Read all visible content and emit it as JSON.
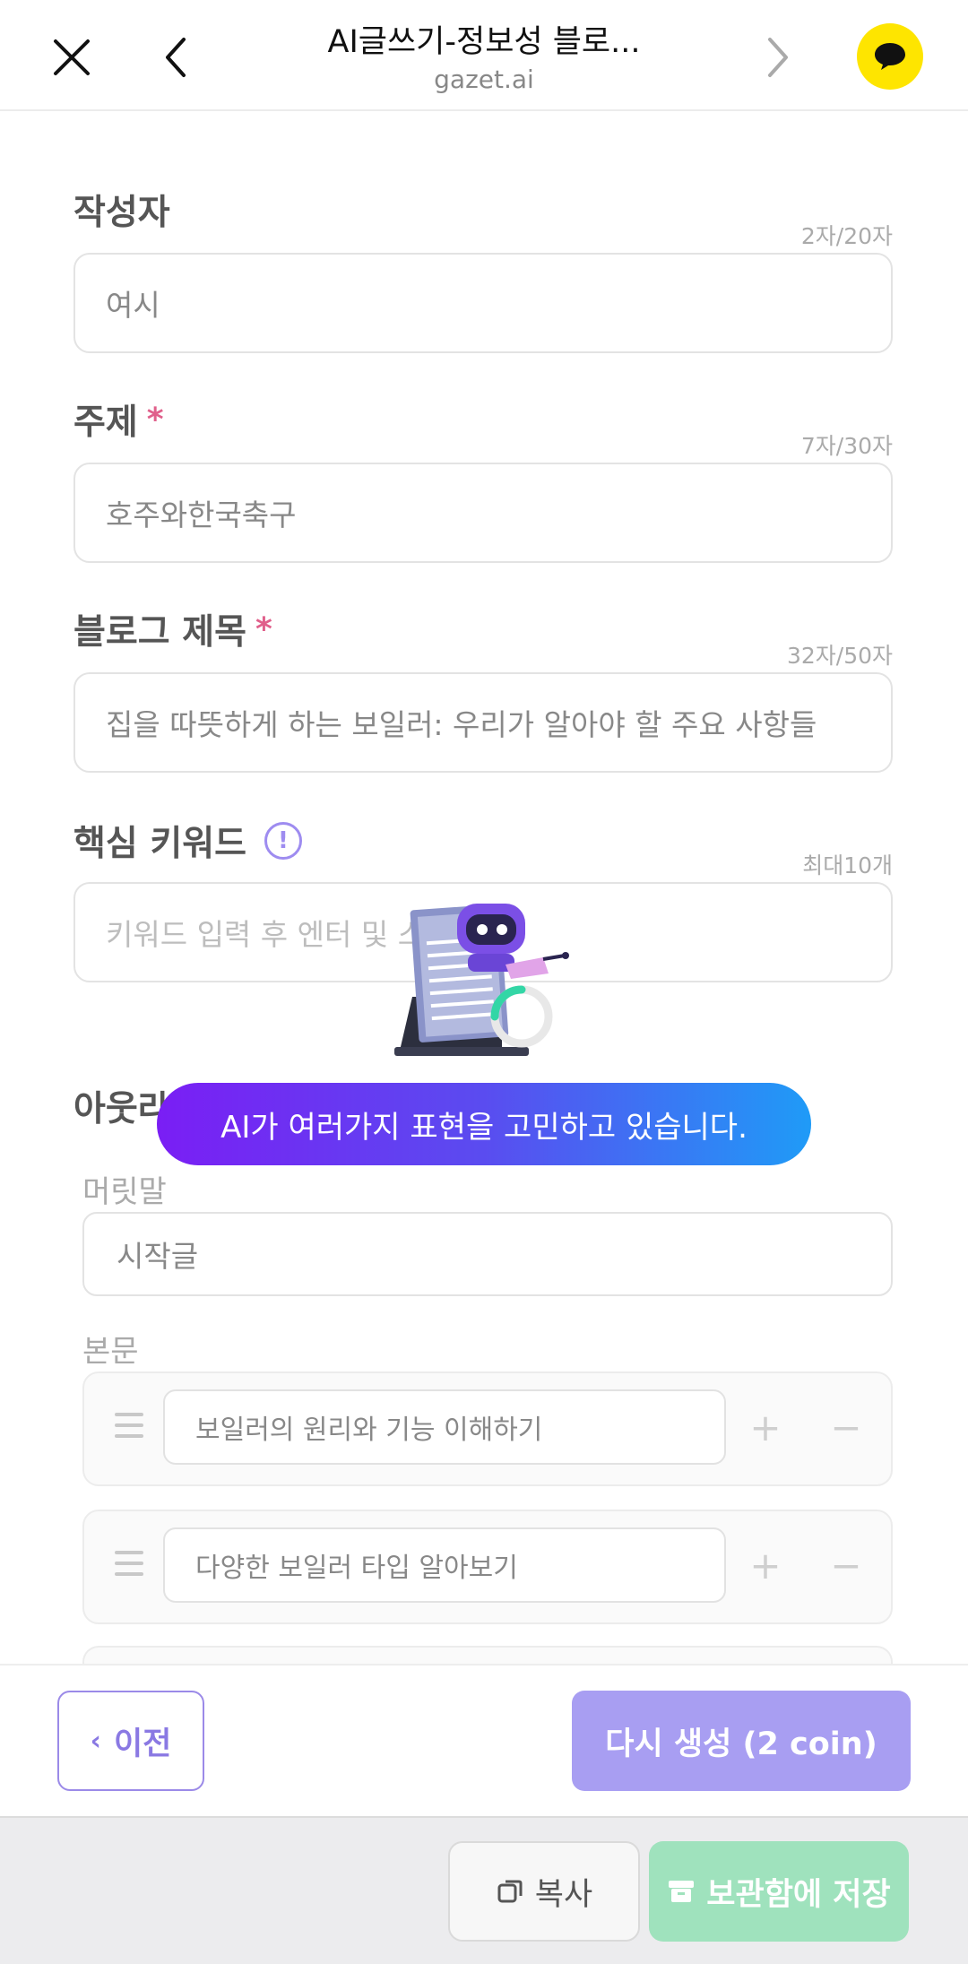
{
  "browser": {
    "title": "AI글쓰기-정보성 블로...",
    "url": "gazet.ai"
  },
  "form": {
    "author": {
      "label": "작성자",
      "counter": "2자/20자",
      "value": "여시"
    },
    "topic": {
      "label": "주제",
      "required_mark": "*",
      "counter": "7자/30자",
      "value": "호주와한국축구"
    },
    "blog_title": {
      "label": "블로그 제목",
      "required_mark": "*",
      "counter": "32자/50자",
      "value": "집을 따뜻하게 하는 보일러: 우리가 알아야 할 주요 사항들"
    },
    "keywords": {
      "label": "핵심 키워드",
      "info_icon": "!",
      "counter": "최대10개",
      "placeholder": "키워드 입력 후 엔터 및 스"
    },
    "outline": {
      "label": "아웃라",
      "intro_label": "머릿말",
      "intro_value": "시작글",
      "body_label": "본문",
      "body_items": [
        {
          "value": "보일러의 원리와 기능 이해하기",
          "plus": "+",
          "minus": "−"
        },
        {
          "value": "다양한 보일러 타입 알아보기",
          "plus": "+",
          "minus": "−"
        }
      ]
    }
  },
  "loading": {
    "message": "AI가 여러가지 표현을 고민하고 있습니다."
  },
  "nav": {
    "prev_label": "이전",
    "prev_chevron": "‹",
    "regenerate_label": "다시 생성 (2 coin)"
  },
  "actions": {
    "copy_label": "복사",
    "save_label": "보관함에 저장"
  },
  "colors": {
    "accent": "#a89ef2",
    "save_green": "#9fe2bd",
    "required": "#e0608b",
    "kakao": "#FEE500"
  }
}
